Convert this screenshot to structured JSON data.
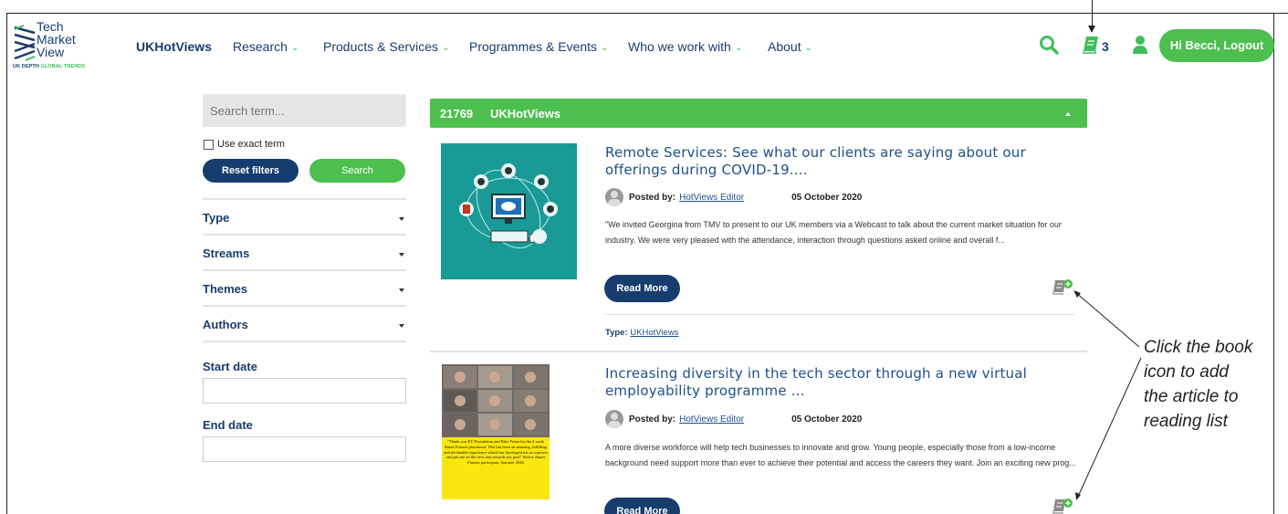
{
  "logo": {
    "line1": "Tech",
    "line2": "Market",
    "line3": "View",
    "sub_a": "UK DEPTH ",
    "sub_b": "GLOBAL TRENDS"
  },
  "nav": {
    "items": [
      {
        "label": "UKHotViews"
      },
      {
        "label": "Research"
      },
      {
        "label": "Products & Services"
      },
      {
        "label": "Programmes & Events"
      },
      {
        "label": "Who we work with"
      },
      {
        "label": "About"
      }
    ],
    "reading_list_count": "3",
    "logout_label": "Hi Becci, Logout"
  },
  "sidebar": {
    "search_placeholder": "Search term...",
    "exact_label": "Use exact term",
    "reset_label": "Reset filters",
    "search_label": "Search",
    "filters": [
      "Type",
      "Streams",
      "Themes",
      "Authors"
    ],
    "start_date_label": "Start date",
    "end_date_label": "End date"
  },
  "results": {
    "count": "21769",
    "stream": "UKHotViews",
    "articles": [
      {
        "title": "Remote Services: See what our clients are saying about our offerings during COVID-19....",
        "posted_by_label": "Posted by:",
        "author": "HotViews Editor",
        "date": "05 October 2020",
        "excerpt": "\"We invited Georgina from TMV to present to our UK members via a Webcast to talk about the current market situation for our industry.  We were very pleased with the attendance, interaction through questions asked online and overall f...",
        "read_more": "Read More",
        "type_label": "Type:",
        "type_value": "UKHotViews"
      },
      {
        "title": "Increasing diversity in the tech sector through a new virtual employability programme ...",
        "posted_by_label": "Posted by:",
        "author": "HotViews Editor",
        "date": "05 October 2020",
        "excerpt": "A more diverse workforce will help tech businesses to innovate and grow. Young people, especially those from a low-income background need support more than ever to achieve their potential and access the careers they want. Join an exciting new prog...",
        "read_more": "Read More",
        "image_quote": "\"Thank you EY Foundation and Blue Prism for the 4 week Smart Futures placement. This has been an amazing, fulfilling and invaluable experience which has developed me as a person and put me on the next step towards my goal\" Sector, Smart Futures participant, Summer 2020"
      }
    ]
  },
  "callout": {
    "line1": "Click the book",
    "line2": "icon to add",
    "line3": "the article to",
    "line4": "reading list"
  },
  "colors": {
    "brand_navy": "#173d6e",
    "brand_green": "#4cbf4f",
    "link_blue": "#1f4f8c"
  }
}
